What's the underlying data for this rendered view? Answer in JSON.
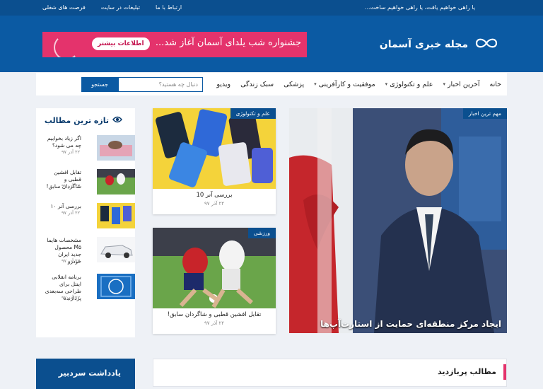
{
  "topbar": {
    "marquee": "یا راهی خواهیم یافت، یا راهی خواهیم ساخت...",
    "links": [
      "ارتباط با ما",
      "تبلیغات در سایت",
      "فرصت های شغلی"
    ]
  },
  "logo": {
    "name": "مجله خبری آسمان",
    "icon": "infinity-icon"
  },
  "banner": {
    "text": "جشنواره شب یلدای آسمان آغاز شد...",
    "cta": "اطلاعات بیشتر"
  },
  "nav": {
    "items": [
      {
        "label": "خانه",
        "has_dropdown": false
      },
      {
        "label": "آخرین اخبار",
        "has_dropdown": true
      },
      {
        "label": "علم و تکنولوژی",
        "has_dropdown": true
      },
      {
        "label": "موفقیت و کارآفرینی",
        "has_dropdown": true
      },
      {
        "label": "پزشکی",
        "has_dropdown": false
      },
      {
        "label": "سبک زندگی",
        "has_dropdown": false
      },
      {
        "label": "ویدیو",
        "has_dropdown": false
      }
    ],
    "search_placeholder": "دنبال چه هستید؟",
    "search_button": "جستجو"
  },
  "hero": {
    "tag": "مهم ترین اخبار",
    "caption": "ایجاد مرکز منطقه‌ای حمایت از استارت‌آپ‌ها"
  },
  "cards": [
    {
      "tag": "علم و تکنولوژی",
      "title": "بررسی آنر 10",
      "date": "۲۲ آذر ۹۷"
    },
    {
      "tag": "ورزشی",
      "title": "تقابل افشین قطبی و شاگردان سابق!",
      "date": "۲۲ آذر ۹۷"
    }
  ],
  "latest": {
    "title": "تازه ترین مطالب",
    "icon": "eye-icon",
    "items": [
      {
        "title": "اگر زیاد بخوابیم چه می شود؟",
        "date": "۲۲ آذر ۹۷"
      },
      {
        "title": "تقابل افشین قطبی و شاگردان سابق!",
        "date": "۲۲ آذر ۹۷"
      },
      {
        "title": "بررسی آنر ۱۰",
        "date": "۲۲ آذر ۹۷"
      },
      {
        "title": "مشخصات هایما M۵ محصول جدید ایران خودرو",
        "date": "۲۲ آذر ۹۷"
      },
      {
        "title": "برنامه انقلابی اینتل برای طراحی سه‌بعدی پردازنده",
        "date": "۲۲ آذر ۹۷"
      }
    ]
  },
  "editor": {
    "title": "یادداشت سردبیر"
  },
  "popular": {
    "title": "مطالب پربازدید"
  },
  "colors": {
    "primary": "#0b5aa3",
    "dark": "#0b4f8f",
    "accent": "#e4336c",
    "page_bg": "#eef1f6"
  }
}
